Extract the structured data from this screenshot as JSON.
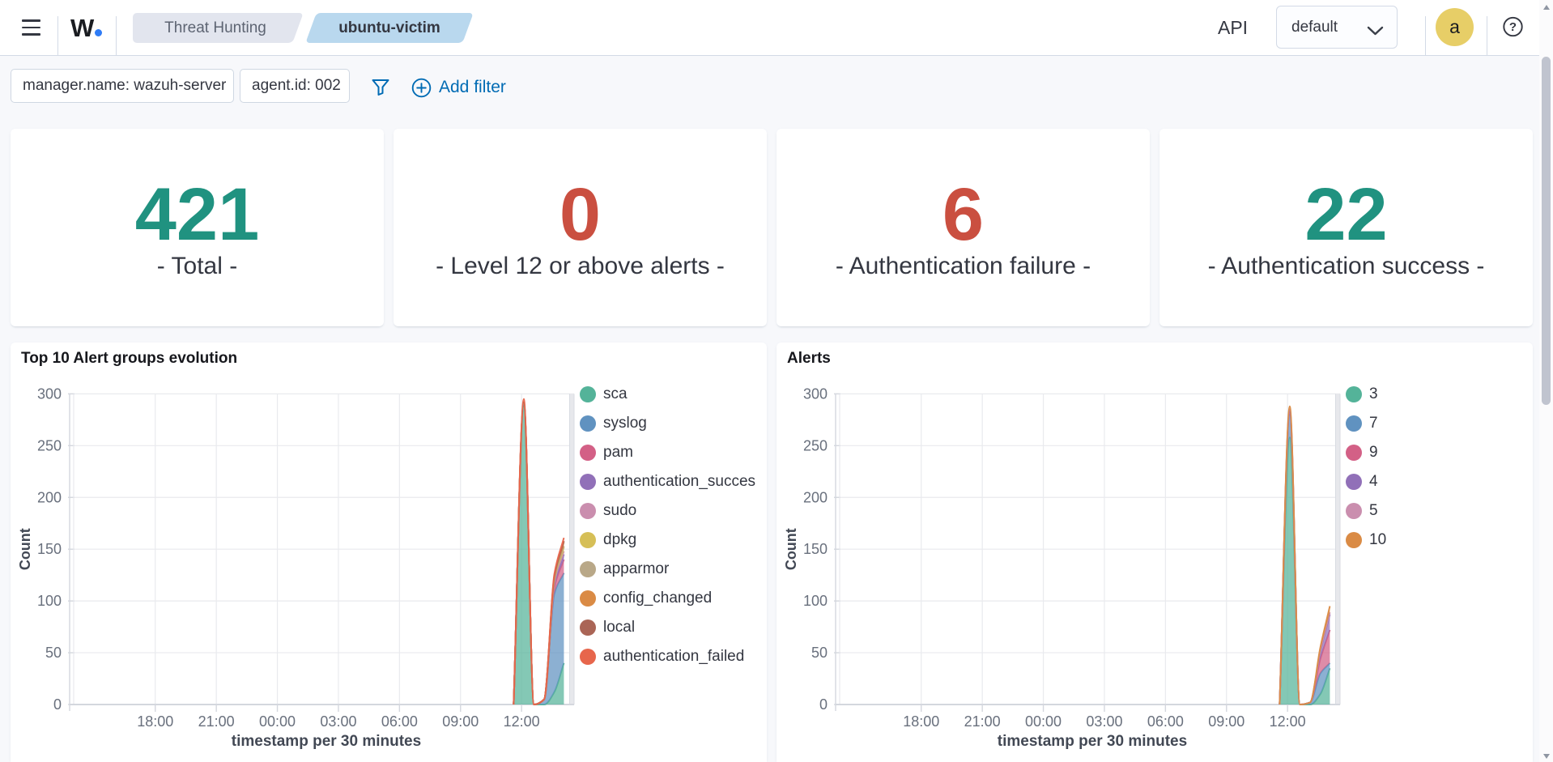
{
  "header": {
    "logo_text": "W",
    "logo_dot": ".",
    "breadcrumbs": [
      {
        "label": "Threat Hunting"
      },
      {
        "label": "ubuntu-victim"
      }
    ],
    "api_label": "API",
    "api_selected_value": "default",
    "avatar_initial": "a",
    "icons": [
      "menu-icon",
      "chevron-down-icon",
      "help-icon"
    ]
  },
  "filter_bar": {
    "filters": [
      {
        "label": "manager.name: wazuh-server"
      },
      {
        "label": "agent.id: 002"
      }
    ],
    "add_filter_label": "Add filter",
    "accent_color": "#006BB4"
  },
  "metrics": [
    {
      "value": "421",
      "label": "- Total -",
      "color": "#209280"
    },
    {
      "value": "0",
      "label": "- Level 12 or above alerts -",
      "color": "#CA4F40"
    },
    {
      "value": "6",
      "label": "- Authentication failure -",
      "color": "#CA4F40"
    },
    {
      "value": "22",
      "label": "- Authentication success -",
      "color": "#209280"
    }
  ],
  "chart_data": [
    {
      "type": "area",
      "stacked": true,
      "title": "Top 10 Alert groups evolution",
      "xlabel": "timestamp per 30 minutes",
      "ylabel": "Count",
      "ylim": [
        0,
        300
      ],
      "y_ticks": [
        0,
        50,
        100,
        150,
        200,
        250,
        300
      ],
      "x_ticks": [
        {
          "label": "18:00",
          "h": 3.77
        },
        {
          "label": "21:00",
          "h": 6.77
        },
        {
          "label": "00:00",
          "h": 9.77
        },
        {
          "label": "03:00",
          "h": 12.77
        },
        {
          "label": "06:00",
          "h": 15.77
        },
        {
          "label": "09:00",
          "h": 18.77
        },
        {
          "label": "12:00",
          "h": 21.77
        }
      ],
      "domain_hours": 24.35,
      "endzone_start_h": 24.13,
      "grid": true,
      "legend_position": "right",
      "bucket_hours": [
        21.38,
        21.88,
        22.38,
        22.88,
        23.38,
        23.85
      ],
      "series": [
        {
          "name": "sca",
          "color": "#54B399",
          "values": [
            0,
            288,
            0,
            0,
            12,
            40
          ]
        },
        {
          "name": "syslog",
          "color": "#6092C0",
          "values": [
            0,
            2,
            0,
            5,
            95,
            87
          ]
        },
        {
          "name": "pam",
          "color": "#D36086",
          "values": [
            0,
            1,
            0,
            0,
            6,
            13
          ]
        },
        {
          "name": "authentication_succes",
          "color": "#9170B8",
          "values": [
            0,
            0,
            0,
            0,
            3,
            5
          ]
        },
        {
          "name": "sudo",
          "color": "#CA8EAE",
          "values": [
            0,
            0,
            0,
            0,
            2,
            3
          ]
        },
        {
          "name": "dpkg",
          "color": "#D6BF57",
          "values": [
            0,
            0,
            0,
            0,
            2,
            4
          ]
        },
        {
          "name": "apparmor",
          "color": "#B9A888",
          "values": [
            0,
            0,
            0,
            0,
            1,
            1
          ]
        },
        {
          "name": "config_changed",
          "color": "#DA8B45",
          "values": [
            0,
            1,
            0,
            0,
            2,
            4
          ]
        },
        {
          "name": "local",
          "color": "#AA6556",
          "values": [
            0,
            0,
            0,
            0,
            1,
            1
          ]
        },
        {
          "name": "authentication_failed",
          "color": "#E7664C",
          "values": [
            0,
            3,
            0,
            0,
            2,
            3
          ]
        }
      ]
    },
    {
      "type": "area",
      "stacked": true,
      "title": "Alerts",
      "xlabel": "timestamp per 30 minutes",
      "ylabel": "Count",
      "ylim": [
        0,
        300
      ],
      "y_ticks": [
        0,
        50,
        100,
        150,
        200,
        250,
        300
      ],
      "x_ticks": [
        {
          "label": "18:00",
          "h": 3.77
        },
        {
          "label": "21:00",
          "h": 6.77
        },
        {
          "label": "00:00",
          "h": 9.77
        },
        {
          "label": "03:00",
          "h": 12.77
        },
        {
          "label": "06:00",
          "h": 15.77
        },
        {
          "label": "09:00",
          "h": 18.77
        },
        {
          "label": "12:00",
          "h": 21.77
        }
      ],
      "domain_hours": 24.35,
      "endzone_start_h": 24.13,
      "grid": true,
      "legend_position": "right",
      "bucket_hours": [
        21.38,
        21.88,
        22.38,
        22.88,
        23.38,
        23.85
      ],
      "series": [
        {
          "name": "3",
          "color": "#54B399",
          "values": [
            0,
            258,
            0,
            0,
            10,
            35
          ]
        },
        {
          "name": "7",
          "color": "#6092C0",
          "values": [
            0,
            22,
            0,
            2,
            20,
            5
          ]
        },
        {
          "name": "9",
          "color": "#D36086",
          "values": [
            0,
            2,
            0,
            0,
            14,
            32
          ]
        },
        {
          "name": "4",
          "color": "#9170B8",
          "values": [
            0,
            2,
            0,
            0,
            7,
            15
          ]
        },
        {
          "name": "5",
          "color": "#CA8EAE",
          "values": [
            0,
            1,
            0,
            0,
            1,
            2
          ]
        },
        {
          "name": "10",
          "color": "#DA8B45",
          "values": [
            0,
            3,
            0,
            0,
            3,
            6
          ]
        }
      ]
    }
  ]
}
